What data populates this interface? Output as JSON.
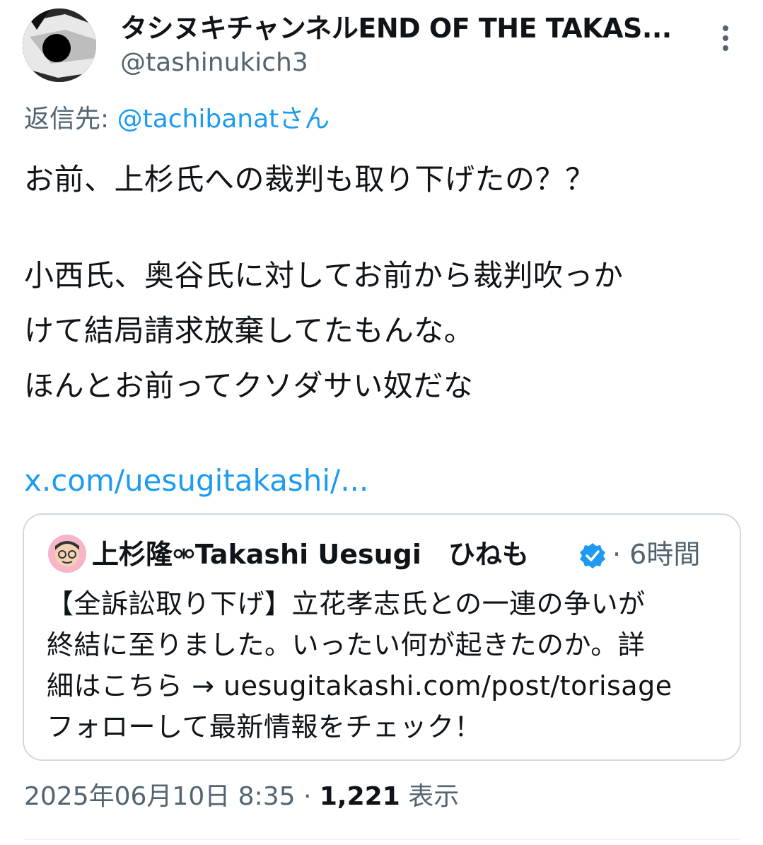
{
  "tweet": {
    "author": {
      "display_name": "タシヌキチャンネルEND OF THE TAKAS...",
      "handle": "@tashinukich3",
      "avatar_icon": "flag-avatar-icon"
    },
    "more_icon": "more-vertical-icon",
    "reply": {
      "prefix": "返信先: ",
      "mention": "@tachibanat",
      "suffix": "さん"
    },
    "body_lines": [
      "お前、上杉氏への裁判も取り下げたの？？",
      "小西氏、奥谷氏に対してお前から裁判吹っか",
      "けて結局請求放棄してたもんな。",
      "ほんとお前ってクソダサい奴だな"
    ],
    "link": "x.com/uesugitakashi/...",
    "quote": {
      "author_name": "上杉隆⚮Takashi Uesugi　ひねも...",
      "verified_icon": "verified-badge-icon",
      "time": "· 6時間",
      "lines": [
        "【全訴訟取り下げ】立花孝志氏との一連の争いが",
        "終結に至りました。いったい何が起きたのか。詳",
        "細はこちら → uesugitakashi.com/post/torisage",
        "フォローして最新情報をチェック！"
      ]
    },
    "meta": {
      "datetime": "2025年06月10日 8:35",
      "separator": " · ",
      "views_count": "1,221",
      "views_label": " 表示"
    }
  },
  "colors": {
    "link": "#1d9bf0",
    "secondary_text": "#536471",
    "primary_text": "#0f1419",
    "border": "#cfd9de"
  }
}
